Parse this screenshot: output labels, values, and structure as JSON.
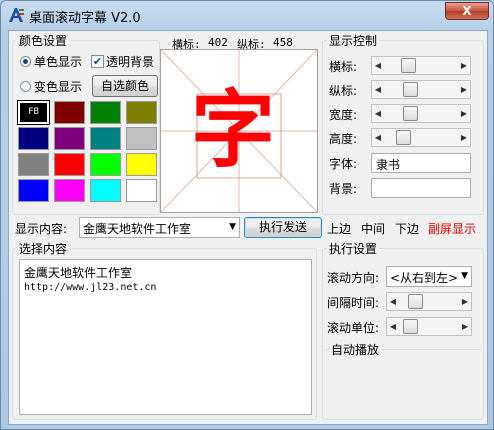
{
  "window": {
    "title": "桌面滚动字幕 V2.0",
    "close_label": "X"
  },
  "color_settings": {
    "legend": "颜色设置",
    "mode_single": "单色显示",
    "mode_transparent": "透明背景",
    "mode_gradient": "变色显示",
    "custom_button": "自选颜色",
    "selected_swatch_label": "FB",
    "swatches": [
      "#000000",
      "#800000",
      "#008000",
      "#808000",
      "#000080",
      "#800080",
      "#008080",
      "#c0c0c0",
      "#808080",
      "#ff0000",
      "#00ff00",
      "#ffff00",
      "#0000ff",
      "#ff00ff",
      "#00ffff",
      "#ffffff"
    ]
  },
  "preview": {
    "x_label": "横标:",
    "x_value": "402",
    "y_label": "纵标:",
    "y_value": "458",
    "glyph": "字",
    "glyph_color": "#ff0000"
  },
  "display_control": {
    "legend": "显示控制",
    "rows": [
      {
        "label": "横标:",
        "value_pct": 28
      },
      {
        "label": "纵标:",
        "value_pct": 32
      },
      {
        "label": "宽度:",
        "value_pct": 32
      },
      {
        "label": "高度:",
        "value_pct": 20
      }
    ],
    "font_label": "字体:",
    "font_value": "隶书",
    "bg_label": "背景:",
    "bg_value": ""
  },
  "content_bar": {
    "label": "显示内容:",
    "combo_value": "金鹰天地软件工作室",
    "send_button": "执行发送",
    "pos_top": "上边",
    "pos_middle": "中间",
    "pos_bottom": "下边",
    "sub_screen": "副屏显示"
  },
  "select_content": {
    "legend": "选择内容",
    "lines": [
      "金鹰天地软件工作室",
      "http://www.jl23.net.cn"
    ]
  },
  "exec_settings": {
    "legend": "执行设置",
    "direction_label": "滚动方向:",
    "direction_value": "<从右到左>",
    "interval_label": "间隔时间:",
    "interval_pct": 20,
    "unit_label": "滚动单位:",
    "unit_pct": 8,
    "autoplay_legend": "自动播放"
  }
}
